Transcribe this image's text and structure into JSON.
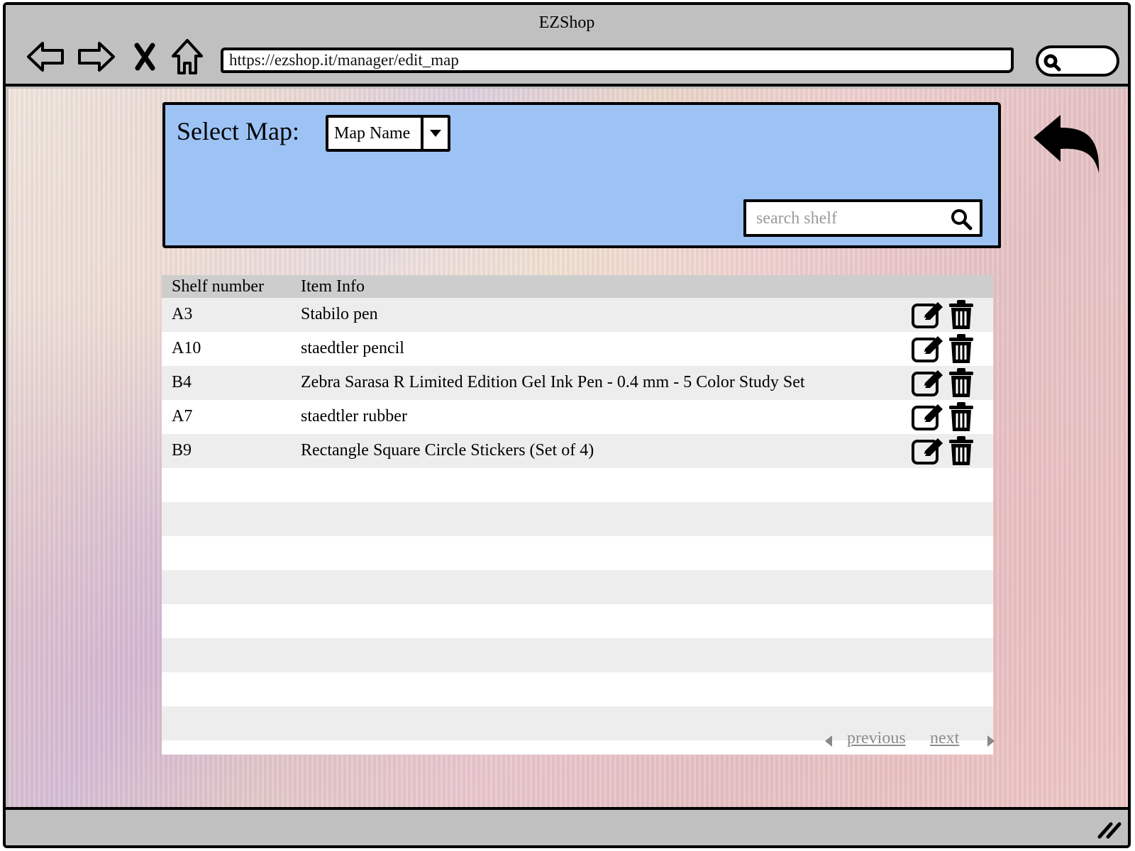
{
  "window": {
    "title": "EZShop"
  },
  "browser": {
    "url": "https://ezshop.it/manager/edit_map",
    "nav": {
      "back": "back-icon",
      "forward": "forward-icon",
      "stop": "close-icon",
      "home": "home-icon"
    }
  },
  "panel": {
    "select_label": "Select Map:",
    "map_select": {
      "value": "Map Name"
    },
    "search": {
      "placeholder": "search shelf",
      "value": ""
    }
  },
  "table": {
    "headers": {
      "shelf": "Shelf number",
      "item": "Item Info"
    },
    "rows": [
      {
        "shelf": "A3",
        "item": "Stabilo pen"
      },
      {
        "shelf": "A10",
        "item": "staedtler pencil"
      },
      {
        "shelf": "B4",
        "item": "Zebra Sarasa R Limited Edition Gel Ink Pen - 0.4 mm - 5 Color Study Set"
      },
      {
        "shelf": "A7",
        "item": "staedtler rubber"
      },
      {
        "shelf": "B9",
        "item": "Rectangle Square Circle Stickers (Set of 4)"
      }
    ]
  },
  "pager": {
    "previous": "previous",
    "next": "next"
  },
  "colors": {
    "panel": "#9dc3f5",
    "header_row": "#cdcdcd",
    "striped_row": "#ededed",
    "chrome": "#c0c0c0"
  }
}
